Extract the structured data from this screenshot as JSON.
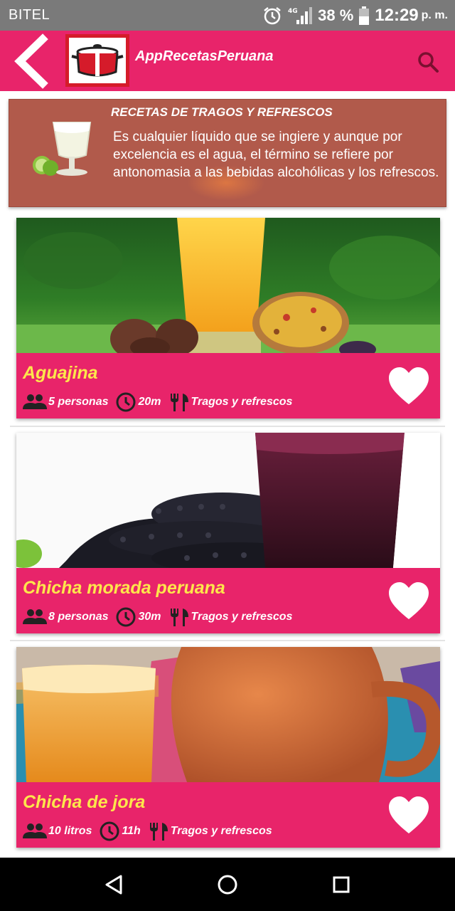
{
  "status_bar": {
    "carrier": "BITEL",
    "network": "4G",
    "battery_percent": "38 %",
    "time": "12:29",
    "ampm": "p. m."
  },
  "app_bar": {
    "title": "AppRecetasPeruana",
    "accent_color": "#e8246a"
  },
  "category": {
    "title": "RECETAS DE TRAGOS Y REFRESCOS",
    "description": "Es cualquier líquido que se ingiere y aunque por excelencia es el agua, el término se refiere por antonomasia a las bebidas alcohólicas y los refrescos."
  },
  "recipes": [
    {
      "name": "Aguajina",
      "servings": "5 personas",
      "time": "20m",
      "category": "Tragos y refrescos",
      "favorite": false
    },
    {
      "name": "Chicha morada peruana",
      "servings": "8 personas",
      "time": "30m",
      "category": "Tragos y refrescos",
      "favorite": false
    },
    {
      "name": "Chicha de jora",
      "servings": "10 litros",
      "time": "11h",
      "category": "Tragos y refrescos",
      "favorite": false
    }
  ],
  "icons": {
    "back": "chevron-left-icon",
    "search": "search-icon",
    "servings": "people-icon",
    "time": "clock-icon",
    "category": "fork-knife-icon",
    "favorite": "heart-icon"
  },
  "colors": {
    "name_yellow": "#fde64b",
    "banner_brown": "#b15a4b"
  }
}
